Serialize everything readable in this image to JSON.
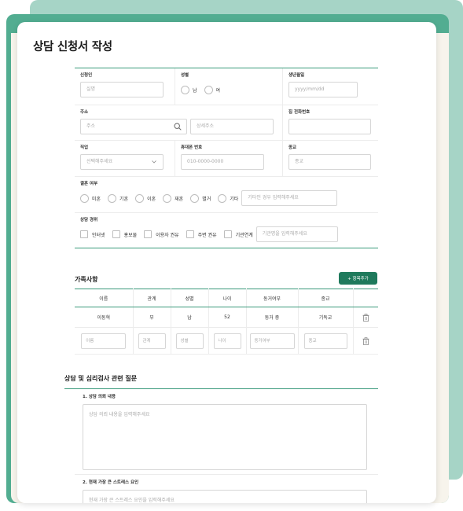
{
  "page_title": "상담 신청서 작성",
  "applicant": {
    "name_label": "신청인",
    "name_placeholder": "실명",
    "gender_label": "성별",
    "gender_options": [
      "남",
      "여"
    ],
    "birth_label": "생년월일",
    "birth_placeholder": "yyyy/mm/dd",
    "address_label": "주소",
    "address_placeholder": "주소",
    "address_detail_placeholder": "상세주소",
    "home_phone_label": "집 전화번호",
    "job_label": "직업",
    "job_placeholder": "선택해주세요",
    "mobile_label": "휴대폰 번호",
    "mobile_placeholder": "010-0000-0000",
    "religion_label": "종교",
    "religion_placeholder": "종교",
    "marital_label": "결혼 여부",
    "marital_options": [
      "미혼",
      "기혼",
      "이혼",
      "재혼",
      "별거",
      "기타"
    ],
    "marital_other_placeholder": "기타인 경우 입력해주세요",
    "route_label": "상담 경위",
    "route_options": [
      "인터넷",
      "홍보물",
      "이용자 권유",
      "주변 권유",
      "기관연계"
    ],
    "route_org_placeholder": "기관명을 입력해주세요"
  },
  "family": {
    "title": "가족사항",
    "add_button": "+ 항목추가",
    "columns": [
      "이름",
      "관계",
      "성별",
      "나이",
      "동거여부",
      "종교"
    ],
    "rows": [
      {
        "name": "이동혁",
        "relation": "부",
        "gender": "남",
        "age": "52",
        "cohabit": "동거 중",
        "religion": "기독교"
      }
    ],
    "input_placeholders": [
      "이름",
      "관계",
      "성별",
      "나이",
      "동거여부",
      "종교"
    ]
  },
  "questions": {
    "title": "상담 및 심리검사 관련 질문",
    "q1_label": "1. 상담 의뢰 내용",
    "q1_placeholder": "상담 의뢰 내용을 입력해주세요",
    "q2_label": "2. 현재 가장 큰 스트레스 요인",
    "q2_placeholder": "현재 가장 큰 스트레스 요인을 입력해주세요"
  },
  "colors": {
    "accent": "#3a9a7b",
    "header_band": "#52ad91",
    "back_band": "#a6d4c6",
    "button": "#1f7a5c"
  }
}
